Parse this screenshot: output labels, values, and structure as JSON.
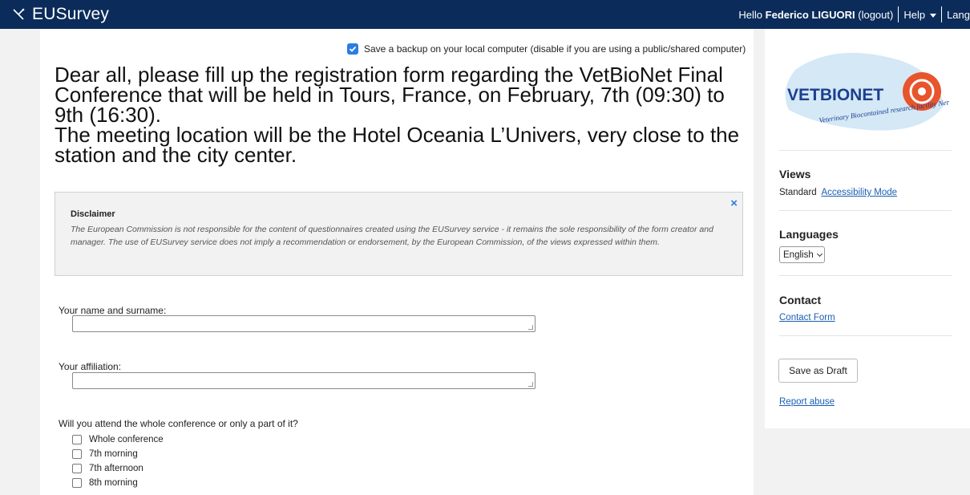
{
  "header": {
    "brand": "EUSurvey",
    "greeting": "Hello",
    "user_name": "Federico LIGUORI",
    "logout": "(logout)",
    "help": "Help",
    "languages_short": "Lang"
  },
  "backup": {
    "label": "Save a backup on your local computer (disable if you are using a public/shared computer)",
    "checked": true
  },
  "title": {
    "line1": "Dear all, please fill up the registration form regarding the VetBioNet Final Conference that will be held in Tours, France, on February, 7th (09:30) to 9th (16:30).",
    "line2": "The meeting location will be the Hotel Oceania L’Univers, very close to the station and the city center."
  },
  "disclaimer": {
    "title": "Disclaimer",
    "text": "The European Commission is not responsible for the content of questionnaires created using the EUSurvey service - it remains the sole responsibility of the form creator and manager. The use of EUSurvey service does not imply a recommendation or endorsement, by the European Commission, of the views expressed within them.",
    "close": "×"
  },
  "questions": {
    "name_label": "Your name and surname:",
    "name_value": "",
    "affiliation_label": "Your affiliation:",
    "affiliation_value": "",
    "attendance_label": "Will you attend the whole conference or only a part of it?",
    "attendance_options": [
      "Whole conference",
      "7th morning",
      "7th afternoon",
      "8th morning"
    ]
  },
  "sidebar": {
    "logo": {
      "name": "VETBIONET",
      "tagline": "Veterinary Biocontained research facility Network"
    },
    "views_heading": "Views",
    "views_standard": "Standard",
    "views_accessibility": "Accessibility Mode",
    "languages_heading": "Languages",
    "language_selected": "English",
    "contact_heading": "Contact",
    "contact_link": "Contact Form",
    "save_draft": "Save as Draft",
    "report_abuse": "Report abuse"
  },
  "colors": {
    "topbar": "#0b2c5a",
    "accent": "#2a7de1",
    "link": "#1a5fb4"
  }
}
